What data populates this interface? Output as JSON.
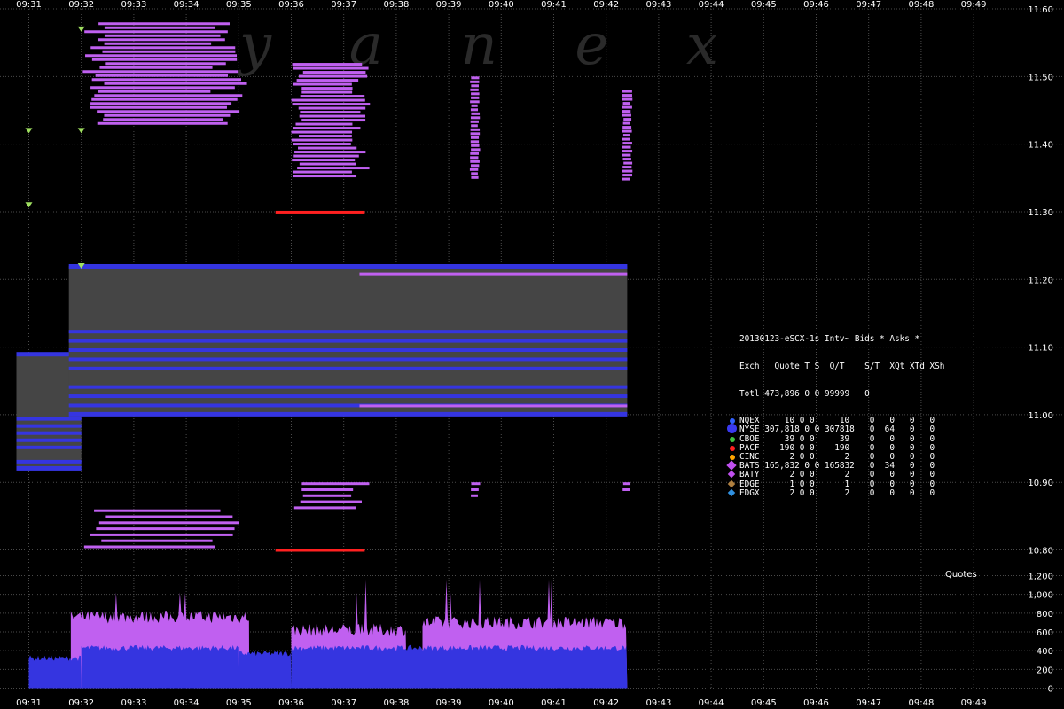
{
  "watermark": "y a n e x",
  "quotes_label": "Quotes",
  "legend": {
    "title": "20130123-eSCX-1s Intv~ Bids * Asks *",
    "header": "Exch   Quote T S  Q/T    S/T  XQt XTd XSh",
    "total": "Totl 473,896 0 0 99999   0",
    "rows": [
      {
        "text": "NQEX     10 0 0     10    0   0   0   0",
        "color": "#3060ff",
        "marker": "dot"
      },
      {
        "text": "NYSE 307,818 0 0 307818   0  64   0   0",
        "color": "#3a3af0",
        "marker": "dot-big"
      },
      {
        "text": "CBOE     39 0 0     39    0   0   0   0",
        "color": "#40c040",
        "marker": "dot"
      },
      {
        "text": "PACF    190 0 0    190    0   0   0   0",
        "color": "#ff2020",
        "marker": "dot"
      },
      {
        "text": "CINC      2 0 0      2    0   0   0   0",
        "color": "#ffa500",
        "marker": "dot"
      },
      {
        "text": "BATS 165,832 0 0 165832   0  34   0   0",
        "color": "#c050f0",
        "marker": "diamond-big"
      },
      {
        "text": "BATY      2 0 0      2    0   0   0   0",
        "color": "#c050f0",
        "marker": "diamond"
      },
      {
        "text": "EDGE      1 0 0      1    0   0   0   0",
        "color": "#b08040",
        "marker": "diamond"
      },
      {
        "text": "EDGX      2 0 0      2    0   0   0   0",
        "color": "#3090e0",
        "marker": "diamond"
      }
    ]
  },
  "colors": {
    "background": "#000000",
    "grid": "#4a4a4a",
    "nyse": "#3535e0",
    "bats": "#c060f0",
    "pacf": "#ff2020",
    "cboe": "#a0e060",
    "spread_fill": "#454545"
  },
  "chart_data": [
    {
      "type": "scatter",
      "title": "",
      "x_ticks": [
        "09:31",
        "09:32",
        "09:33",
        "09:34",
        "09:35",
        "09:36",
        "09:37",
        "09:38",
        "09:39",
        "09:40",
        "09:41",
        "09:42",
        "09:43",
        "09:44",
        "09:45",
        "09:46",
        "09:47",
        "09:48",
        "09:49"
      ],
      "y_ticks": [
        "11.60",
        "11.50",
        "11.40",
        "11.30",
        "11.20",
        "11.10",
        "11.00",
        "10.90",
        "10.80"
      ],
      "ylim": [
        10.78,
        11.6
      ],
      "xlim_minutes": [
        "09:31",
        "09:49"
      ],
      "series": [
        {
          "name": "NYSE",
          "nbbo_band": [
            {
              "from": "09:31",
              "to": "09:32",
              "bid": 10.92,
              "ask": 11.09
            },
            {
              "from": "09:32",
              "to": "09:42.4",
              "bid": 11.0,
              "ask": 11.22
            }
          ]
        },
        {
          "name": "BATS",
          "quote_clusters": [
            {
              "from": "09:32",
              "to": "09:35.2",
              "bid_range": [
                10.8,
                10.86
              ],
              "ask_range": [
                11.43,
                11.58
              ]
            },
            {
              "from": "09:36",
              "to": "09:37.5",
              "bid_range": [
                10.86,
                10.9
              ],
              "ask_range": [
                11.35,
                11.52
              ]
            },
            {
              "from": "09:39.4",
              "to": "09:39.6",
              "bid_range": [
                10.88,
                10.9
              ],
              "ask_range": [
                11.35,
                11.5
              ]
            },
            {
              "from": "09:42.3",
              "to": "09:42.5",
              "bid_range": [
                10.89,
                10.9
              ],
              "ask_range": [
                11.35,
                11.48
              ]
            }
          ]
        },
        {
          "name": "PACF",
          "quote_clusters": [
            {
              "from": "09:35.7",
              "to": "09:37.4",
              "bid": 10.8,
              "ask": 11.3
            }
          ]
        },
        {
          "name": "CBOE",
          "points": [
            {
              "x": "09:31",
              "y": 11.31
            },
            {
              "x": "09:31",
              "y": 11.42
            },
            {
              "x": "09:32",
              "y": 11.42
            },
            {
              "x": "09:32",
              "y": 11.57
            },
            {
              "x": "09:32",
              "y": 11.22
            }
          ]
        }
      ]
    },
    {
      "type": "area",
      "ylabel": "Quotes",
      "y_ticks": [
        "1,200",
        "1,000",
        "800",
        "600",
        "400",
        "200",
        "0"
      ],
      "ylim": [
        0,
        1200
      ],
      "series": [
        {
          "name": "NYSE",
          "segments": [
            {
              "from": "09:31",
              "to": "09:32",
              "level": 320
            },
            {
              "from": "09:32",
              "to": "09:35",
              "level": 430
            },
            {
              "from": "09:35",
              "to": "09:36",
              "level": 370
            },
            {
              "from": "09:36",
              "to": "09:42.4",
              "level": 430
            }
          ]
        },
        {
          "name": "BATS",
          "segments": [
            {
              "from": "09:31.8",
              "to": "09:35.2",
              "level": 760
            },
            {
              "from": "09:36",
              "to": "09:38.2",
              "level": 620
            },
            {
              "from": "09:38.5",
              "to": "09:42.4",
              "level": 700
            }
          ],
          "peaks": [
            1150,
            1100,
            1020
          ]
        }
      ]
    }
  ]
}
